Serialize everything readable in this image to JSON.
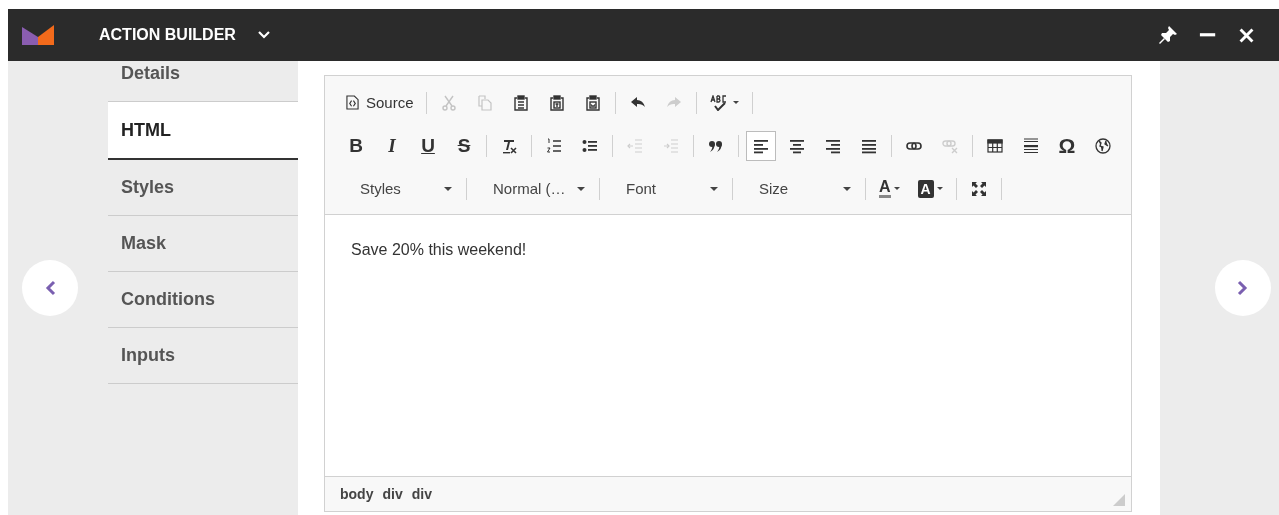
{
  "window": {
    "title": "ACTION BUILDER"
  },
  "nav": [
    {
      "label": "Details",
      "selected": false
    },
    {
      "label": "HTML",
      "selected": true
    },
    {
      "label": "Styles",
      "selected": false
    },
    {
      "label": "Mask",
      "selected": false
    },
    {
      "label": "Conditions",
      "selected": false
    },
    {
      "label": "Inputs",
      "selected": false
    }
  ],
  "toolbar": [
    [
      {
        "kind": "source",
        "label": "Source",
        "disabled": false,
        "selected": false
      },
      {
        "kind": "sep"
      },
      {
        "kind": "cut",
        "disabled": true,
        "selected": false
      },
      {
        "kind": "copy",
        "disabled": true,
        "selected": false
      },
      {
        "kind": "paste",
        "disabled": false,
        "selected": false
      },
      {
        "kind": "paste-text",
        "disabled": false,
        "selected": false
      },
      {
        "kind": "paste-word",
        "disabled": false,
        "selected": false
      },
      {
        "kind": "sep"
      },
      {
        "kind": "undo",
        "disabled": false,
        "selected": false
      },
      {
        "kind": "redo",
        "disabled": true,
        "selected": false
      },
      {
        "kind": "sep"
      },
      {
        "kind": "spellcheck",
        "disabled": false,
        "selected": false
      },
      {
        "kind": "sep"
      }
    ],
    [
      {
        "kind": "bold",
        "label": "B",
        "disabled": false,
        "selected": false
      },
      {
        "kind": "italic",
        "label": "I",
        "disabled": false,
        "selected": false
      },
      {
        "kind": "underline",
        "label": "U",
        "disabled": false,
        "selected": false
      },
      {
        "kind": "strike",
        "label": "S",
        "disabled": false,
        "selected": false
      },
      {
        "kind": "sep"
      },
      {
        "kind": "remove-format",
        "disabled": false,
        "selected": false
      },
      {
        "kind": "sep"
      },
      {
        "kind": "numbered-list",
        "disabled": false,
        "selected": false
      },
      {
        "kind": "bullet-list",
        "disabled": false,
        "selected": false
      },
      {
        "kind": "sep"
      },
      {
        "kind": "outdent",
        "disabled": true,
        "selected": false
      },
      {
        "kind": "indent",
        "disabled": true,
        "selected": false
      },
      {
        "kind": "sep"
      },
      {
        "kind": "blockquote",
        "disabled": false,
        "selected": false
      },
      {
        "kind": "sep"
      },
      {
        "kind": "align-left",
        "disabled": false,
        "selected": true
      },
      {
        "kind": "align-center",
        "disabled": false,
        "selected": false
      },
      {
        "kind": "align-right",
        "disabled": false,
        "selected": false
      },
      {
        "kind": "justify",
        "disabled": false,
        "selected": false
      },
      {
        "kind": "sep"
      },
      {
        "kind": "link",
        "disabled": false,
        "selected": false
      },
      {
        "kind": "unlink",
        "disabled": true,
        "selected": false
      },
      {
        "kind": "sep"
      },
      {
        "kind": "table",
        "disabled": false,
        "selected": false
      },
      {
        "kind": "rule",
        "disabled": false,
        "selected": false
      },
      {
        "kind": "special",
        "label": "Ω",
        "disabled": false,
        "selected": false
      },
      {
        "kind": "globe",
        "disabled": false,
        "selected": false
      }
    ],
    [
      {
        "kind": "dropdown",
        "label": "Styles",
        "disabled": false,
        "selected": false
      },
      {
        "kind": "sep"
      },
      {
        "kind": "dropdown",
        "label": "Normal (…",
        "disabled": false,
        "selected": false
      },
      {
        "kind": "sep"
      },
      {
        "kind": "dropdown",
        "label": "Font",
        "disabled": false,
        "selected": false
      },
      {
        "kind": "sep"
      },
      {
        "kind": "dropdown",
        "label": "Size",
        "disabled": false,
        "selected": false
      },
      {
        "kind": "sep"
      },
      {
        "kind": "text-color",
        "label": "A",
        "disabled": false,
        "selected": false
      },
      {
        "kind": "bg-color",
        "label": "A",
        "disabled": false,
        "selected": false
      },
      {
        "kind": "sep"
      },
      {
        "kind": "maximize",
        "disabled": false,
        "selected": false
      },
      {
        "kind": "sep"
      }
    ]
  ],
  "content": "Save 20% this weekend!",
  "path": [
    "body",
    "div",
    "div"
  ]
}
